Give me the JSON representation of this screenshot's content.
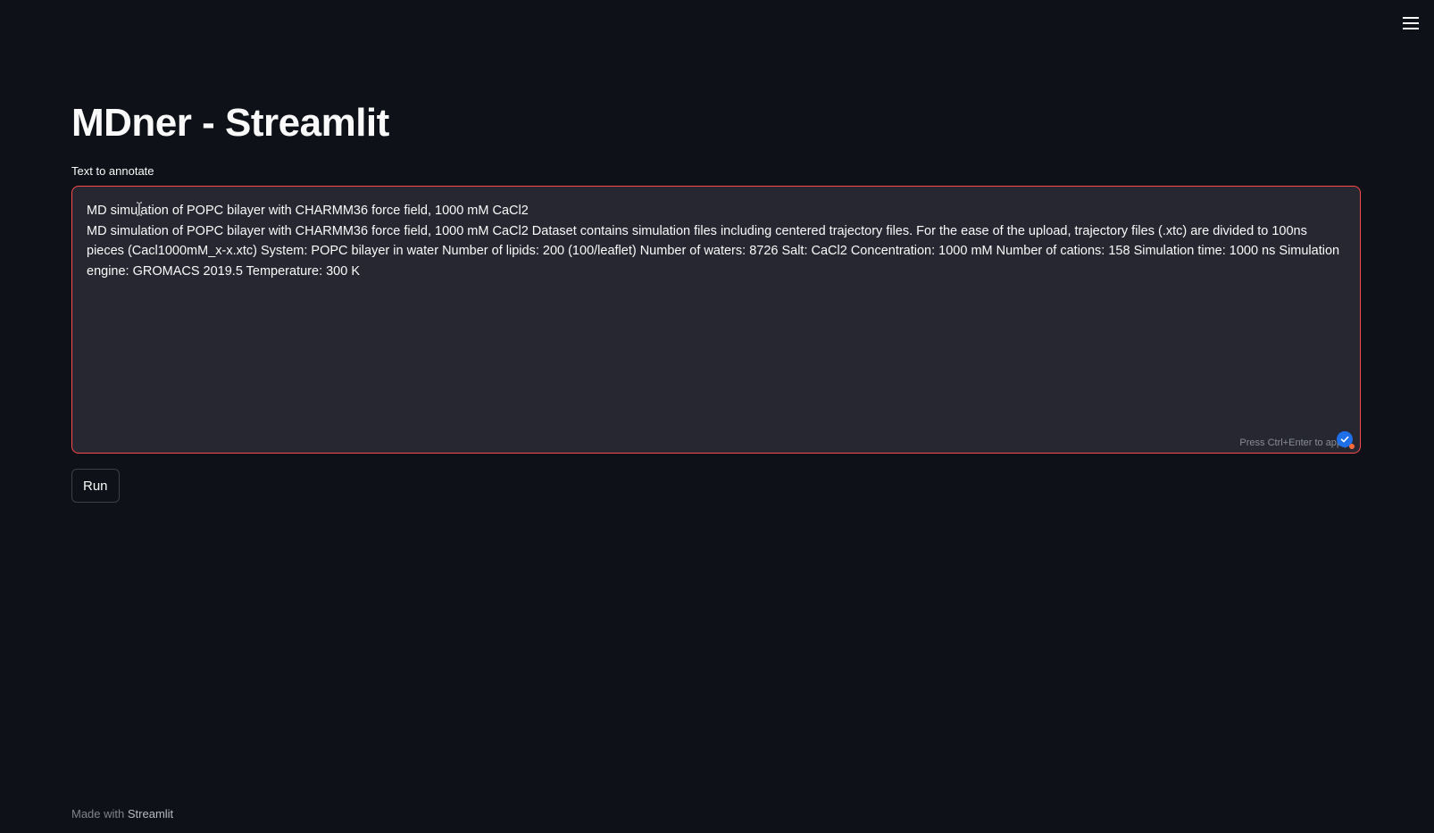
{
  "app": {
    "title": "MDner - Streamlit"
  },
  "menu": {
    "icon": "hamburger-menu-icon"
  },
  "annotate": {
    "label": "Text to annotate",
    "value": "MD simulation of POPC bilayer with CHARMM36 force field, 1000 mM CaCl2\nMD simulation of POPC bilayer with CHARMM36 force field, 1000 mM CaCl2 Dataset contains simulation files including centered trajectory files. For the ease of the upload, trajectory files (.xtc) are divided to 100ns pieces (Cacl1000mM_x-x.xtc) System: POPC bilayer in water Number of lipids: 200 (100/leaflet) Number of waters: 8726 Salt: CaCl2 Concentration: 1000 mM Number of cations: 158 Simulation time: 1000 ns Simulation engine: GROMACS 2019.5 Temperature: 300 K",
    "hint": "Press Ctrl+Enter to apply",
    "border_color": "#ff4b4b"
  },
  "run_button": {
    "label": "Run"
  },
  "footer": {
    "prefix": "Made with",
    "brand": "Streamlit"
  },
  "colors": {
    "background": "#0e1117",
    "field_background": "#262730",
    "accent": "#ff4b4b",
    "text": "#fafafa"
  }
}
